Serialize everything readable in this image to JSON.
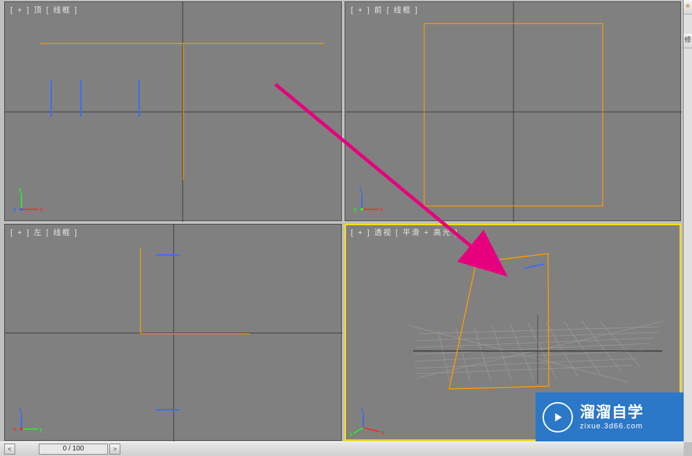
{
  "viewports": {
    "top": {
      "label": "[ + ] 顶 [ 线框 ]",
      "axis": {
        "x": {
          "label": "x",
          "color": "#ff2020"
        },
        "y": {
          "label": "y",
          "color": "#20ff20"
        },
        "z": {
          "label": "z",
          "color": "#3060ff"
        }
      }
    },
    "front": {
      "label": "[ + ] 前 [ 线框 ]",
      "axis": {
        "x": {
          "label": "x",
          "color": "#ff2020"
        },
        "y": {
          "label": "y",
          "color": "#20ff20"
        },
        "z": {
          "label": "z",
          "color": "#3060ff"
        }
      }
    },
    "left": {
      "label": "[ + ] 左 [ 线框 ]",
      "axis": {
        "x": {
          "label": "x",
          "color": "#ff2020"
        },
        "y": {
          "label": "y",
          "color": "#20ff20"
        },
        "z": {
          "label": "z",
          "color": "#3060ff"
        }
      }
    },
    "persp": {
      "label": "[ + ] 透视 [ 平滑 + 高光 ]",
      "axis": {
        "x": {
          "label": "x",
          "color": "#ff2020"
        },
        "y": {
          "label": "y",
          "color": "#20ff20"
        },
        "z": {
          "label": "z",
          "color": "#3060ff"
        }
      }
    }
  },
  "sidebar": {
    "mod_label": "修"
  },
  "bottombar": {
    "time_display": "0 / 100"
  },
  "watermark": {
    "title": "溜溜自学",
    "url": "zixue.3d66.com"
  },
  "colors": {
    "wire_orange": "#ff9a00",
    "wire_blue": "#3a6df0",
    "arrow": "#e6007e",
    "vp_bg": "#808080",
    "cross": "#3a3a3a"
  }
}
